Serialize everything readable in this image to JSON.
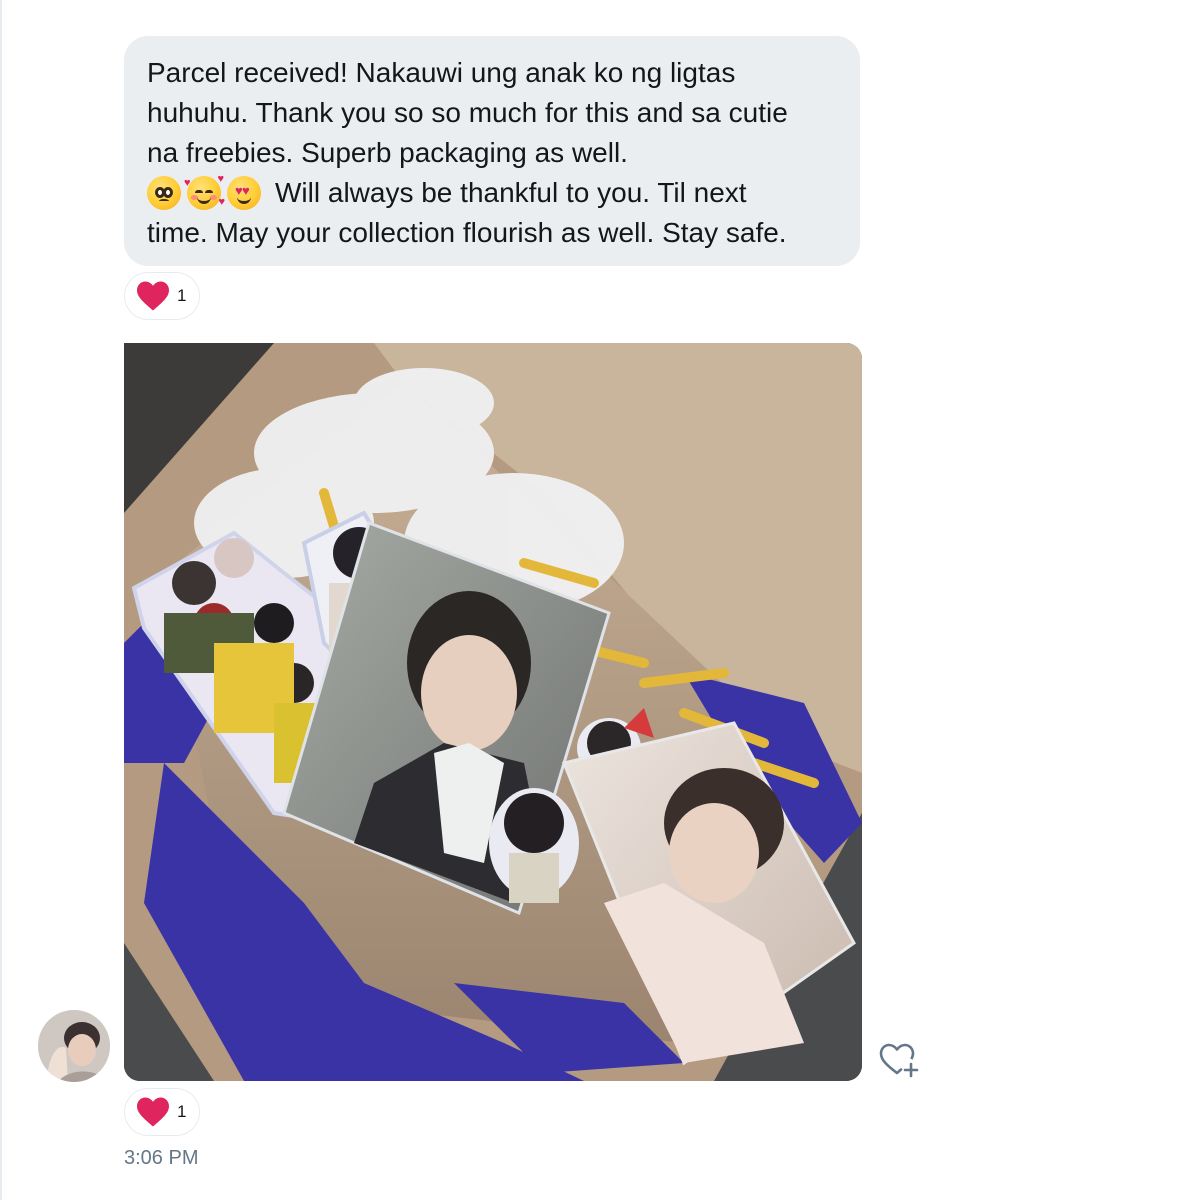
{
  "message": {
    "lines": [
      "Parcel received! Nakauwi ung anak ko ng ligtas",
      "huhuhu. Thank you so so much for this and sa cutie",
      "na freebies. Superb packaging as well.",
      "Will always be thankful to you. Til next",
      "time. May your collection flourish as well. Stay safe."
    ],
    "emojis": [
      "pleading-face-emoji",
      "smiling-face-with-hearts-emoji",
      "heart-eyes-emoji"
    ],
    "reaction": {
      "icon": "heart-icon",
      "count": "1"
    }
  },
  "image_message": {
    "description_icon": "photo-attachment",
    "reaction": {
      "icon": "heart-icon",
      "count": "1"
    }
  },
  "add_reaction": {
    "icon": "heart-plus-icon"
  },
  "timestamp": "3:06 PM",
  "colors": {
    "bubble": "#ebeef0",
    "heart": "#e0245e",
    "secondary_text": "#657786",
    "icon": "#657786"
  }
}
